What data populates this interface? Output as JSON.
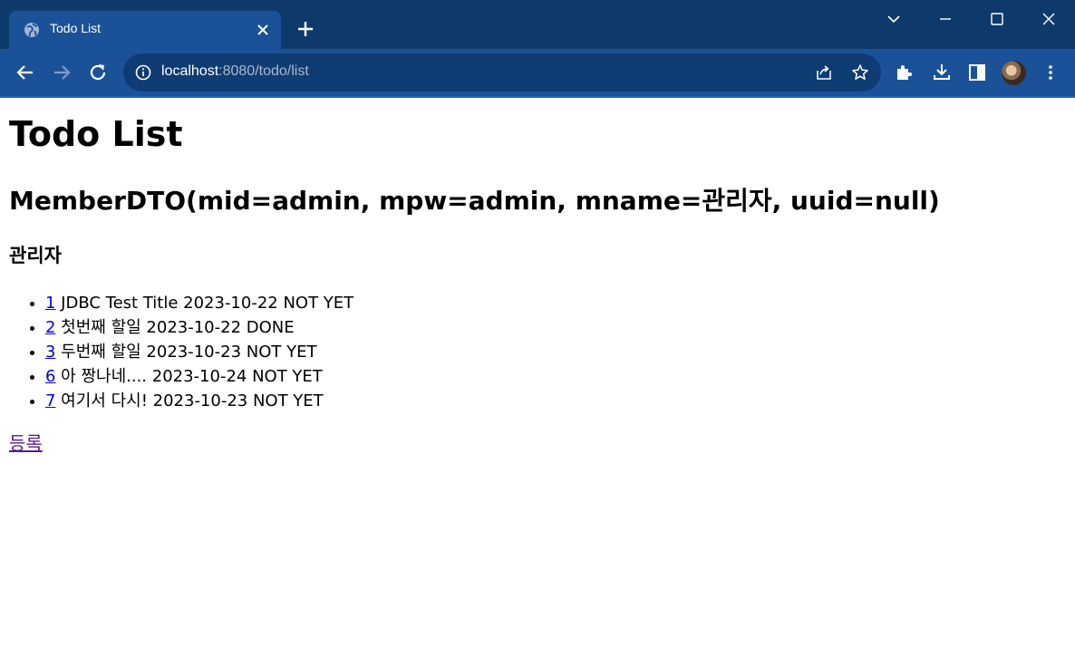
{
  "browser": {
    "tab_title": "Todo List",
    "url_host": "localhost",
    "url_path": ":8080/todo/list"
  },
  "page": {
    "heading": "Todo List",
    "member_info": "MemberDTO(mid=admin, mpw=admin, mname=관리자, uuid=null)",
    "member_name": "관리자",
    "todos": [
      {
        "tno": "1",
        "text": " JDBC Test Title 2023-10-22 NOT YET"
      },
      {
        "tno": "2",
        "text": " 첫번째 할일 2023-10-22 DONE"
      },
      {
        "tno": "3",
        "text": " 두번째 할일 2023-10-23 NOT YET"
      },
      {
        "tno": "6",
        "text": " 아 짱나네.... 2023-10-24 NOT YET"
      },
      {
        "tno": "7",
        "text": " 여기서 다시! 2023-10-23 NOT YET"
      }
    ],
    "register_link": "등록"
  }
}
